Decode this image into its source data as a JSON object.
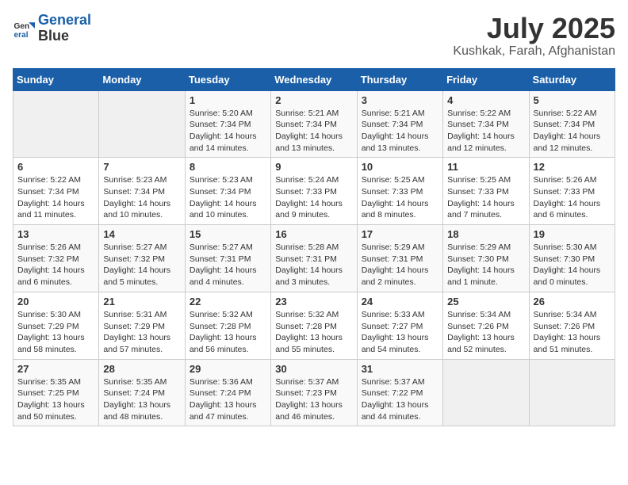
{
  "header": {
    "logo_line1": "General",
    "logo_line2": "Blue",
    "month": "July 2025",
    "location": "Kushkak, Farah, Afghanistan"
  },
  "weekdays": [
    "Sunday",
    "Monday",
    "Tuesday",
    "Wednesday",
    "Thursday",
    "Friday",
    "Saturday"
  ],
  "weeks": [
    [
      {
        "day": "",
        "info": ""
      },
      {
        "day": "",
        "info": ""
      },
      {
        "day": "1",
        "info": "Sunrise: 5:20 AM\nSunset: 7:34 PM\nDaylight: 14 hours\nand 14 minutes."
      },
      {
        "day": "2",
        "info": "Sunrise: 5:21 AM\nSunset: 7:34 PM\nDaylight: 14 hours\nand 13 minutes."
      },
      {
        "day": "3",
        "info": "Sunrise: 5:21 AM\nSunset: 7:34 PM\nDaylight: 14 hours\nand 13 minutes."
      },
      {
        "day": "4",
        "info": "Sunrise: 5:22 AM\nSunset: 7:34 PM\nDaylight: 14 hours\nand 12 minutes."
      },
      {
        "day": "5",
        "info": "Sunrise: 5:22 AM\nSunset: 7:34 PM\nDaylight: 14 hours\nand 12 minutes."
      }
    ],
    [
      {
        "day": "6",
        "info": "Sunrise: 5:22 AM\nSunset: 7:34 PM\nDaylight: 14 hours\nand 11 minutes."
      },
      {
        "day": "7",
        "info": "Sunrise: 5:23 AM\nSunset: 7:34 PM\nDaylight: 14 hours\nand 10 minutes."
      },
      {
        "day": "8",
        "info": "Sunrise: 5:23 AM\nSunset: 7:34 PM\nDaylight: 14 hours\nand 10 minutes."
      },
      {
        "day": "9",
        "info": "Sunrise: 5:24 AM\nSunset: 7:33 PM\nDaylight: 14 hours\nand 9 minutes."
      },
      {
        "day": "10",
        "info": "Sunrise: 5:25 AM\nSunset: 7:33 PM\nDaylight: 14 hours\nand 8 minutes."
      },
      {
        "day": "11",
        "info": "Sunrise: 5:25 AM\nSunset: 7:33 PM\nDaylight: 14 hours\nand 7 minutes."
      },
      {
        "day": "12",
        "info": "Sunrise: 5:26 AM\nSunset: 7:33 PM\nDaylight: 14 hours\nand 6 minutes."
      }
    ],
    [
      {
        "day": "13",
        "info": "Sunrise: 5:26 AM\nSunset: 7:32 PM\nDaylight: 14 hours\nand 6 minutes."
      },
      {
        "day": "14",
        "info": "Sunrise: 5:27 AM\nSunset: 7:32 PM\nDaylight: 14 hours\nand 5 minutes."
      },
      {
        "day": "15",
        "info": "Sunrise: 5:27 AM\nSunset: 7:31 PM\nDaylight: 14 hours\nand 4 minutes."
      },
      {
        "day": "16",
        "info": "Sunrise: 5:28 AM\nSunset: 7:31 PM\nDaylight: 14 hours\nand 3 minutes."
      },
      {
        "day": "17",
        "info": "Sunrise: 5:29 AM\nSunset: 7:31 PM\nDaylight: 14 hours\nand 2 minutes."
      },
      {
        "day": "18",
        "info": "Sunrise: 5:29 AM\nSunset: 7:30 PM\nDaylight: 14 hours\nand 1 minute."
      },
      {
        "day": "19",
        "info": "Sunrise: 5:30 AM\nSunset: 7:30 PM\nDaylight: 14 hours\nand 0 minutes."
      }
    ],
    [
      {
        "day": "20",
        "info": "Sunrise: 5:30 AM\nSunset: 7:29 PM\nDaylight: 13 hours\nand 58 minutes."
      },
      {
        "day": "21",
        "info": "Sunrise: 5:31 AM\nSunset: 7:29 PM\nDaylight: 13 hours\nand 57 minutes."
      },
      {
        "day": "22",
        "info": "Sunrise: 5:32 AM\nSunset: 7:28 PM\nDaylight: 13 hours\nand 56 minutes."
      },
      {
        "day": "23",
        "info": "Sunrise: 5:32 AM\nSunset: 7:28 PM\nDaylight: 13 hours\nand 55 minutes."
      },
      {
        "day": "24",
        "info": "Sunrise: 5:33 AM\nSunset: 7:27 PM\nDaylight: 13 hours\nand 54 minutes."
      },
      {
        "day": "25",
        "info": "Sunrise: 5:34 AM\nSunset: 7:26 PM\nDaylight: 13 hours\nand 52 minutes."
      },
      {
        "day": "26",
        "info": "Sunrise: 5:34 AM\nSunset: 7:26 PM\nDaylight: 13 hours\nand 51 minutes."
      }
    ],
    [
      {
        "day": "27",
        "info": "Sunrise: 5:35 AM\nSunset: 7:25 PM\nDaylight: 13 hours\nand 50 minutes."
      },
      {
        "day": "28",
        "info": "Sunrise: 5:35 AM\nSunset: 7:24 PM\nDaylight: 13 hours\nand 48 minutes."
      },
      {
        "day": "29",
        "info": "Sunrise: 5:36 AM\nSunset: 7:24 PM\nDaylight: 13 hours\nand 47 minutes."
      },
      {
        "day": "30",
        "info": "Sunrise: 5:37 AM\nSunset: 7:23 PM\nDaylight: 13 hours\nand 46 minutes."
      },
      {
        "day": "31",
        "info": "Sunrise: 5:37 AM\nSunset: 7:22 PM\nDaylight: 13 hours\nand 44 minutes."
      },
      {
        "day": "",
        "info": ""
      },
      {
        "day": "",
        "info": ""
      }
    ]
  ]
}
